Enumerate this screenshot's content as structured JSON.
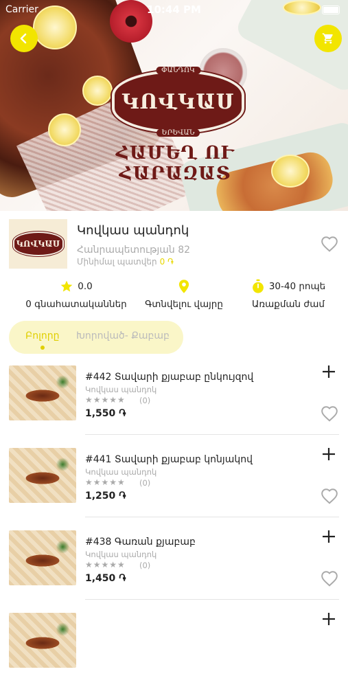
{
  "status": {
    "carrier": "Carrier",
    "time": "10:44 PM"
  },
  "hero": {
    "brand_top": "ՓԱՆԴՈԿ",
    "brand_name": "ԿՈՎԿԱՍ",
    "brand_bottom": "ԵՐԵՎԱՆ",
    "tagline": "ՀԱՄԵՂ ՈՒ ՀԱՐԱԶԱՏ"
  },
  "restaurant": {
    "logo_text": "ԿՈՎԿԱՍ",
    "name": "Կովկաս պանդոկ",
    "address": "Հանրապետության 82",
    "min_order_label": "Մինիմալ պատվեր",
    "min_order_value": "0 ֏"
  },
  "stats": {
    "rating_value": "0.0",
    "rating_label": "0 գնահատականներ",
    "location_label": "Գտնվելու վայրը",
    "time_value": "30-40 րոպե",
    "time_label": "Առաքման ժամ"
  },
  "tabs": [
    {
      "label": "Բոլորը",
      "active": true
    },
    {
      "label": "Խորոված- Քաբաբ",
      "active": false
    }
  ],
  "items": [
    {
      "title": "#442 Տավարի քյաբաբ ընկույզով",
      "restaurant": "Կովկաս պանդոկ",
      "stars": "★★★★★",
      "reviews": "(0)",
      "price": "1,550 ֏"
    },
    {
      "title": "#441 Տավարի քյաբաբ կոնյակով",
      "restaurant": "Կովկաս պանդոկ",
      "stars": "★★★★★",
      "reviews": "(0)",
      "price": "1,250 ֏"
    },
    {
      "title": "#438 Գառան քյաբաբ",
      "restaurant": "Կովկաս պանդոկ",
      "stars": "★★★★★",
      "reviews": "(0)",
      "price": "1,450 ֏"
    },
    {
      "title": "",
      "restaurant": "",
      "stars": "",
      "reviews": "",
      "price": ""
    }
  ],
  "colors": {
    "accent": "#f2e500",
    "brand": "#6e1a17",
    "muted": "#aaaaaa"
  }
}
